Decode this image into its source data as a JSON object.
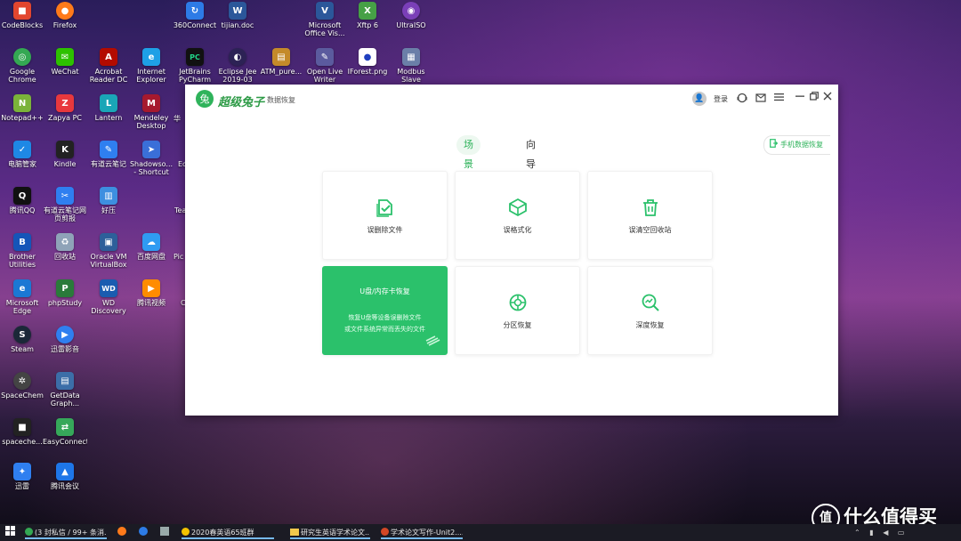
{
  "desktop": {
    "icons": [
      {
        "label": "CodeBlocks",
        "color": "#e2462f",
        "glyph": "■"
      },
      {
        "label": "Firefox",
        "color": "#ff7a1a",
        "glyph": "●"
      },
      {
        "label": "360Connect",
        "color": "#2d7be6",
        "glyph": "↻"
      },
      {
        "label": "tijian.doc",
        "color": "#2b579a",
        "glyph": "W"
      },
      {
        "label": "Microsoft Office Vis...",
        "color": "#2b579a",
        "glyph": "V"
      },
      {
        "label": "Xftp 6",
        "color": "#46a046",
        "glyph": "X"
      },
      {
        "label": "UltraISO",
        "color": "#7a3fb8",
        "glyph": "◉"
      },
      {
        "label": "Google Chrome",
        "color": "#34a853",
        "glyph": "◎"
      },
      {
        "label": "WeChat",
        "color": "#2dc100",
        "glyph": "✉"
      },
      {
        "label": "Acrobat Reader DC",
        "color": "#b30b00",
        "glyph": "A"
      },
      {
        "label": "Internet Explorer",
        "color": "#1ea0e6",
        "glyph": "e"
      },
      {
        "label": "JetBrains PyCharm C...",
        "color": "#21d789",
        "glyph": "PC"
      },
      {
        "label": "Eclipse Jee 2019-03",
        "color": "#2c2255",
        "glyph": "◐"
      },
      {
        "label": "ATM_pure...",
        "color": "#c48a2a",
        "glyph": "▤"
      },
      {
        "label": "Open Live Writer",
        "color": "#5b5b9e",
        "glyph": "✎"
      },
      {
        "label": "IForest.png",
        "color": "#1f3fbf",
        "glyph": "●"
      },
      {
        "label": "Modbus Slave",
        "color": "#6b7fa8",
        "glyph": "▦"
      },
      {
        "label": "Notepad++",
        "color": "#7bb33a",
        "glyph": "N"
      },
      {
        "label": "Zapya PC",
        "color": "#e8383d",
        "glyph": "Z"
      },
      {
        "label": "Lantern",
        "color": "#1aa6b7",
        "glyph": "L"
      },
      {
        "label": "Mendeley Desktop",
        "color": "#a6192e",
        "glyph": "M"
      },
      {
        "label": "电脑管家",
        "color": "#1e88e5",
        "glyph": "✓"
      },
      {
        "label": "Kindle",
        "color": "#222222",
        "glyph": "K"
      },
      {
        "label": "有道云笔记",
        "color": "#2f7ff0",
        "glyph": "✎"
      },
      {
        "label": "Shadowso... - Shortcut",
        "color": "#3a6fd8",
        "glyph": "➤"
      },
      {
        "label": "腾讯QQ",
        "color": "#111111",
        "glyph": "Q"
      },
      {
        "label": "有道云笔记网页剪报",
        "color": "#2f7ff0",
        "glyph": "✂"
      },
      {
        "label": "好压",
        "color": "#3d8fe0",
        "glyph": "▥"
      },
      {
        "label": "Brother Utilities",
        "color": "#1555b8",
        "glyph": "B"
      },
      {
        "label": "回收站",
        "color": "#8fa3b8",
        "glyph": "♻"
      },
      {
        "label": "Oracle VM VirtualBox",
        "color": "#2d5f9a",
        "glyph": "▣"
      },
      {
        "label": "百度网盘",
        "color": "#2f9bf2",
        "glyph": "☁"
      },
      {
        "label": "Microsoft Edge",
        "color": "#1b78d4",
        "glyph": "e"
      },
      {
        "label": "phpStudy",
        "color": "#2a7a3a",
        "glyph": "P"
      },
      {
        "label": "WD Discovery",
        "color": "#1a5cb0",
        "glyph": "WD"
      },
      {
        "label": "腾讯视频",
        "color": "#ff8c00",
        "glyph": "▶"
      },
      {
        "label": "Steam",
        "color": "#1b2838",
        "glyph": "S"
      },
      {
        "label": "迅雷影音",
        "color": "#2f7ff0",
        "glyph": "▶"
      },
      {
        "label": "SpaceChem",
        "color": "#444444",
        "glyph": "✲"
      },
      {
        "label": "GetData Graph...",
        "color": "#3c6ea8",
        "glyph": "▤"
      },
      {
        "label": "spaceche...",
        "color": "#222222",
        "glyph": "■"
      },
      {
        "label": "EasyConnect",
        "color": "#36a85a",
        "glyph": "⇄"
      },
      {
        "label": "迅雷",
        "color": "#2f7ff0",
        "glyph": "✦"
      },
      {
        "label": "腾讯会议",
        "color": "#1e76e8",
        "glyph": "▲"
      }
    ],
    "partial_labels": [
      "华",
      "Ec",
      "Tea",
      "Pic",
      "C"
    ]
  },
  "app": {
    "logo_glyph": "兔",
    "brand": "超级兔子",
    "subtitle": "数据恢复",
    "login": "登录",
    "icons": {
      "avatar": "person-icon",
      "support": "headset-icon",
      "feedback": "message-icon",
      "menu": "menu-icon",
      "minimize": "minimize-icon",
      "restore": "restore-icon",
      "close": "close-icon"
    },
    "tabs": [
      "场景模式",
      "向导模式"
    ],
    "phone_recovery": "手机数据恢复",
    "cards": [
      {
        "label": "误删除文件",
        "icon": "delete-file-icon"
      },
      {
        "label": "误格式化",
        "icon": "format-box-icon"
      },
      {
        "label": "误清空回收站",
        "icon": "recycle-bin-icon"
      },
      {
        "label": "U盘/内存卡恢复",
        "desc1": "恢复U盘等设备误删除文件",
        "desc2": "或文件系统异常而丢失的文件",
        "icon": "usb-drive-icon"
      },
      {
        "label": "分区恢复",
        "icon": "partition-icon"
      },
      {
        "label": "深度恢复",
        "icon": "deep-scan-icon"
      }
    ],
    "accent": "#2bc16b"
  },
  "taskbar": {
    "items": [
      "(3 封私信 / 99+ 条消...",
      "2020春英语65班群",
      "研究生英语学术论文...",
      "学术论文写作-Unit2...."
    ]
  },
  "watermark": {
    "circle": "值",
    "text": "什么值得买"
  }
}
